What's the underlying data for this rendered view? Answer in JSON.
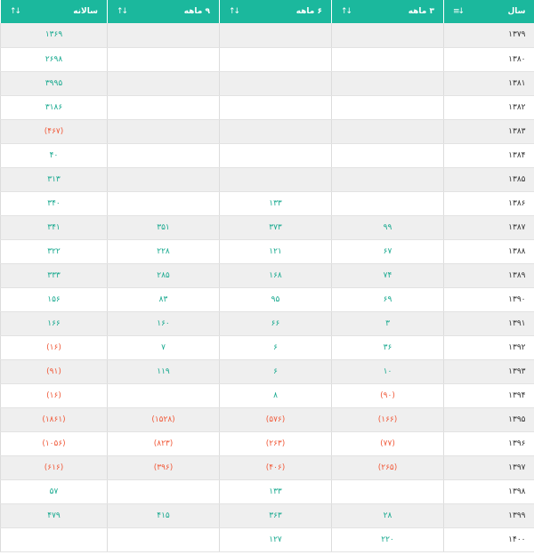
{
  "table": {
    "headers": [
      {
        "key": "year",
        "label": "سال",
        "sort_icon": "sort-desc-icon",
        "sort_glyph": "↓≡"
      },
      {
        "key": "q3",
        "label": "۳ ماهه",
        "sort_icon": "sort-icon",
        "sort_glyph": "↓↑"
      },
      {
        "key": "m6",
        "label": "۶ ماهه",
        "sort_icon": "sort-icon",
        "sort_glyph": "↓↑"
      },
      {
        "key": "m9",
        "label": "۹ ماهه",
        "sort_icon": "sort-icon",
        "sort_glyph": "↓↑"
      },
      {
        "key": "annual",
        "label": "سالانه",
        "sort_icon": "sort-icon",
        "sort_glyph": "↓↑"
      }
    ],
    "rows": [
      {
        "year": "۱۳۷۹",
        "q3": "",
        "m6": "",
        "m9": "",
        "annual": "۱۳۶۹"
      },
      {
        "year": "۱۳۸۰",
        "q3": "",
        "m6": "",
        "m9": "",
        "annual": "۲۶۹۸"
      },
      {
        "year": "۱۳۸۱",
        "q3": "",
        "m6": "",
        "m9": "",
        "annual": "۳۹۹۵"
      },
      {
        "year": "۱۳۸۲",
        "q3": "",
        "m6": "",
        "m9": "",
        "annual": "۳۱۸۶"
      },
      {
        "year": "۱۳۸۳",
        "q3": "",
        "m6": "",
        "m9": "",
        "annual": "(۴۶۷)"
      },
      {
        "year": "۱۳۸۴",
        "q3": "",
        "m6": "",
        "m9": "",
        "annual": "۴۰"
      },
      {
        "year": "۱۳۸۵",
        "q3": "",
        "m6": "",
        "m9": "",
        "annual": "۳۱۳"
      },
      {
        "year": "۱۳۸۶",
        "q3": "",
        "m6": "۱۳۳",
        "m9": "",
        "annual": "۳۴۰"
      },
      {
        "year": "۱۳۸۷",
        "q3": "۹۹",
        "m6": "۳۷۳",
        "m9": "۳۵۱",
        "annual": "۳۴۱"
      },
      {
        "year": "۱۳۸۸",
        "q3": "۶۷",
        "m6": "۱۲۱",
        "m9": "۲۲۸",
        "annual": "۳۲۲"
      },
      {
        "year": "۱۳۸۹",
        "q3": "۷۴",
        "m6": "۱۶۸",
        "m9": "۲۸۵",
        "annual": "۳۳۳"
      },
      {
        "year": "۱۳۹۰",
        "q3": "۶۹",
        "m6": "۹۵",
        "m9": "۸۳",
        "annual": "۱۵۶"
      },
      {
        "year": "۱۳۹۱",
        "q3": "۳",
        "m6": "۶۶",
        "m9": "۱۶۰",
        "annual": "۱۶۶"
      },
      {
        "year": "۱۳۹۲",
        "q3": "۳۶",
        "m6": "۶",
        "m9": "۷",
        "annual": "(۱۶)"
      },
      {
        "year": "۱۳۹۳",
        "q3": "۱۰",
        "m6": "۶",
        "m9": "۱۱۹",
        "annual": "(۹۱)"
      },
      {
        "year": "۱۳۹۴",
        "q3": "(۹۰)",
        "m6": "۸",
        "m9": "",
        "annual": "(۱۶)"
      },
      {
        "year": "۱۳۹۵",
        "q3": "(۱۶۶)",
        "m6": "(۵۷۶)",
        "m9": "(۱۵۲۸)",
        "annual": "(۱۸۶۱)"
      },
      {
        "year": "۱۳۹۶",
        "q3": "(۷۷)",
        "m6": "(۲۶۳)",
        "m9": "(۸۲۳)",
        "annual": "(۱۰۵۶)"
      },
      {
        "year": "۱۳۹۷",
        "q3": "(۲۶۵)",
        "m6": "(۴۰۶)",
        "m9": "(۳۹۶)",
        "annual": "(۶۱۶)"
      },
      {
        "year": "۱۳۹۸",
        "q3": "",
        "m6": "۱۳۳",
        "m9": "",
        "annual": "۵۷"
      },
      {
        "year": "۱۳۹۹",
        "q3": "۲۸",
        "m6": "۳۶۳",
        "m9": "۴۱۵",
        "annual": "۴۷۹"
      },
      {
        "year": "۱۴۰۰",
        "q3": "۲۲۰",
        "m6": "۱۲۷",
        "m9": "",
        "annual": ""
      }
    ]
  },
  "colors": {
    "header_bg": "#1bb89d",
    "positive": "#18a98f",
    "negative": "#f05a3a",
    "row_alt": "#efefef"
  }
}
